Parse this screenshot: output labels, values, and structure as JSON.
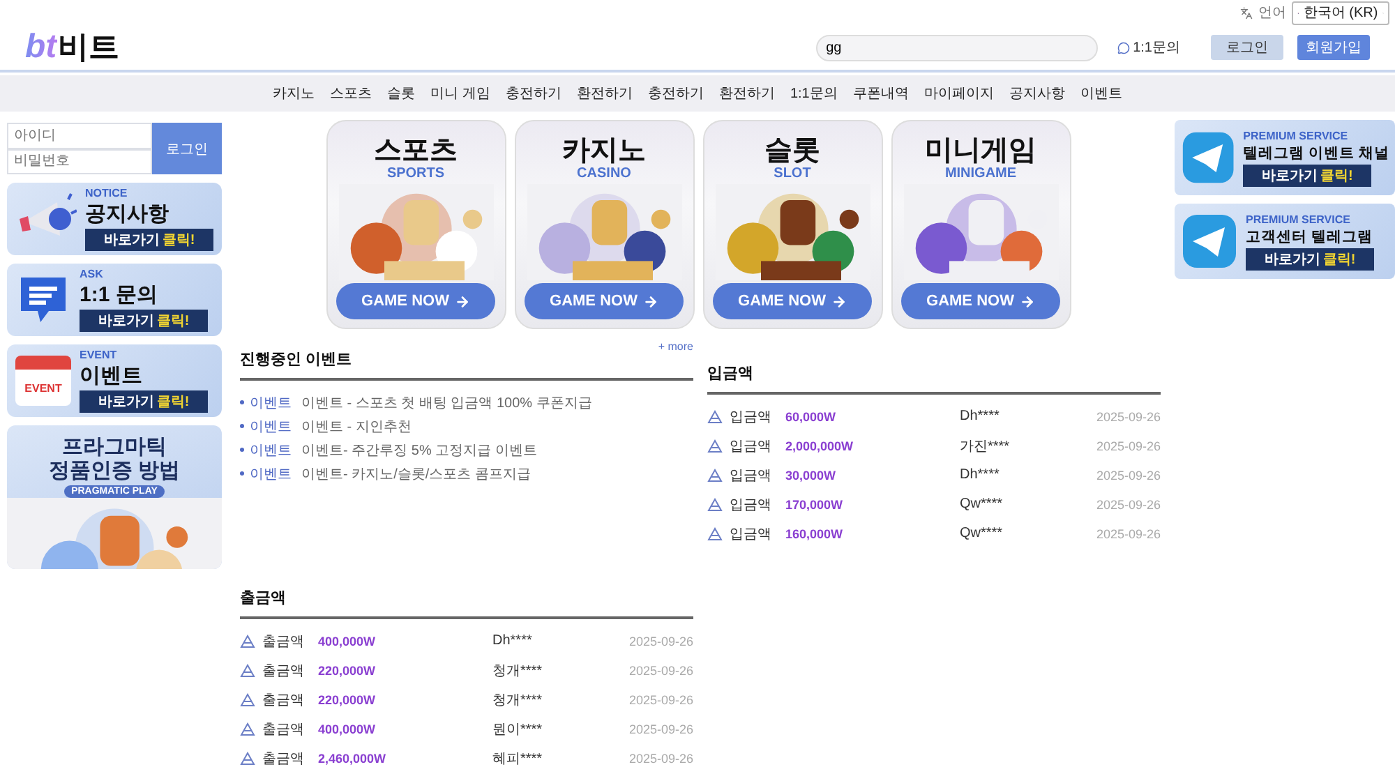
{
  "top_bar": {
    "language_label": "언어",
    "language": "한국어 (KR)"
  },
  "header": {
    "logo_latin": "bt",
    "logo_korean": "비트",
    "search": {
      "value": "gg"
    },
    "inquiry": "1:1문의",
    "login_button": "로그인",
    "signup_button": "회원가입"
  },
  "nav": [
    "카지노",
    "스포츠",
    "슬롯",
    "미니 게임",
    "충전하기",
    "환전하기",
    "충전하기",
    "환전하기",
    "1:1문의",
    "쿠폰내역",
    "마이페이지",
    "공지사항",
    "이벤트"
  ],
  "login_box": {
    "id_placeholder": "아이디",
    "password_placeholder": "비밀번호",
    "button": "로그인"
  },
  "left_banners": [
    {
      "kind": "notice",
      "tag": "NOTICE",
      "title": "공지사항",
      "cta": "바로가기",
      "cta_accent": "클릭!"
    },
    {
      "kind": "ask",
      "tag": "ASK",
      "title": "1:1 문의",
      "cta": "바로가기",
      "cta_accent": "클릭!"
    },
    {
      "kind": "event",
      "tag": "EVENT",
      "title": "이벤트",
      "calendar_label": "EVENT",
      "cta": "바로가기",
      "cta_accent": "클릭!"
    }
  ],
  "promo": {
    "line1": "프라그마틱",
    "line2": "정품인증 방법",
    "brand": "PRAGMATIC PLAY"
  },
  "games": [
    {
      "kind": "sports",
      "title": "스포츠",
      "subtitle": "SPORTS",
      "button": "GAME NOW"
    },
    {
      "kind": "casino",
      "title": "카지노",
      "subtitle": "CASINO",
      "button": "GAME NOW"
    },
    {
      "kind": "slot",
      "title": "슬롯",
      "subtitle": "SLOT",
      "button": "GAME NOW"
    },
    {
      "kind": "minigame",
      "title": "미니게임",
      "subtitle": "MINIGAME",
      "button": "GAME NOW"
    }
  ],
  "events": {
    "title": "진행중인 이벤트",
    "more": "+ more",
    "items": [
      {
        "tag": "이벤트",
        "text": "이벤트 - 스포츠 첫 배팅 입금액 100% 쿠폰지급"
      },
      {
        "tag": "이벤트",
        "text": "이벤트 - 지인추천"
      },
      {
        "tag": "이벤트",
        "text": "이벤트- 주간루징 5% 고정지급 이벤트"
      },
      {
        "tag": "이벤트",
        "text": "이벤트- 카지노/슬롯/스포츠 콤프지급"
      }
    ]
  },
  "deposits": {
    "title": "입금액",
    "rows": [
      {
        "type": "입금액",
        "amount": "60,000W",
        "user": "Dh****",
        "date": "2025-09-26"
      },
      {
        "type": "입금액",
        "amount": "2,000,000W",
        "user": "가진****",
        "date": "2025-09-26"
      },
      {
        "type": "입금액",
        "amount": "30,000W",
        "user": "Dh****",
        "date": "2025-09-26"
      },
      {
        "type": "입금액",
        "amount": "170,000W",
        "user": "Qw****",
        "date": "2025-09-26"
      },
      {
        "type": "입금액",
        "amount": "160,000W",
        "user": "Qw****",
        "date": "2025-09-26"
      }
    ]
  },
  "withdrawals": {
    "title": "출금액",
    "rows": [
      {
        "type": "출금액",
        "amount": "400,000W",
        "user": "Dh****",
        "date": "2025-09-26"
      },
      {
        "type": "출금액",
        "amount": "220,000W",
        "user": "청개****",
        "date": "2025-09-26"
      },
      {
        "type": "출금액",
        "amount": "220,000W",
        "user": "청개****",
        "date": "2025-09-26"
      },
      {
        "type": "출금액",
        "amount": "400,000W",
        "user": "뭔이****",
        "date": "2025-09-26"
      },
      {
        "type": "출금액",
        "amount": "2,460,000W",
        "user": "혜피****",
        "date": "2025-09-26"
      }
    ]
  },
  "right_banners": [
    {
      "tag": "PREMIUM SERVICE",
      "title": "텔레그램 이벤트 채널",
      "cta": "바로가기",
      "cta_accent": "클릭!"
    },
    {
      "tag": "PREMIUM SERVICE",
      "title": "고객센터 텔레그램",
      "cta": "바로가기",
      "cta_accent": "클릭!"
    }
  ]
}
